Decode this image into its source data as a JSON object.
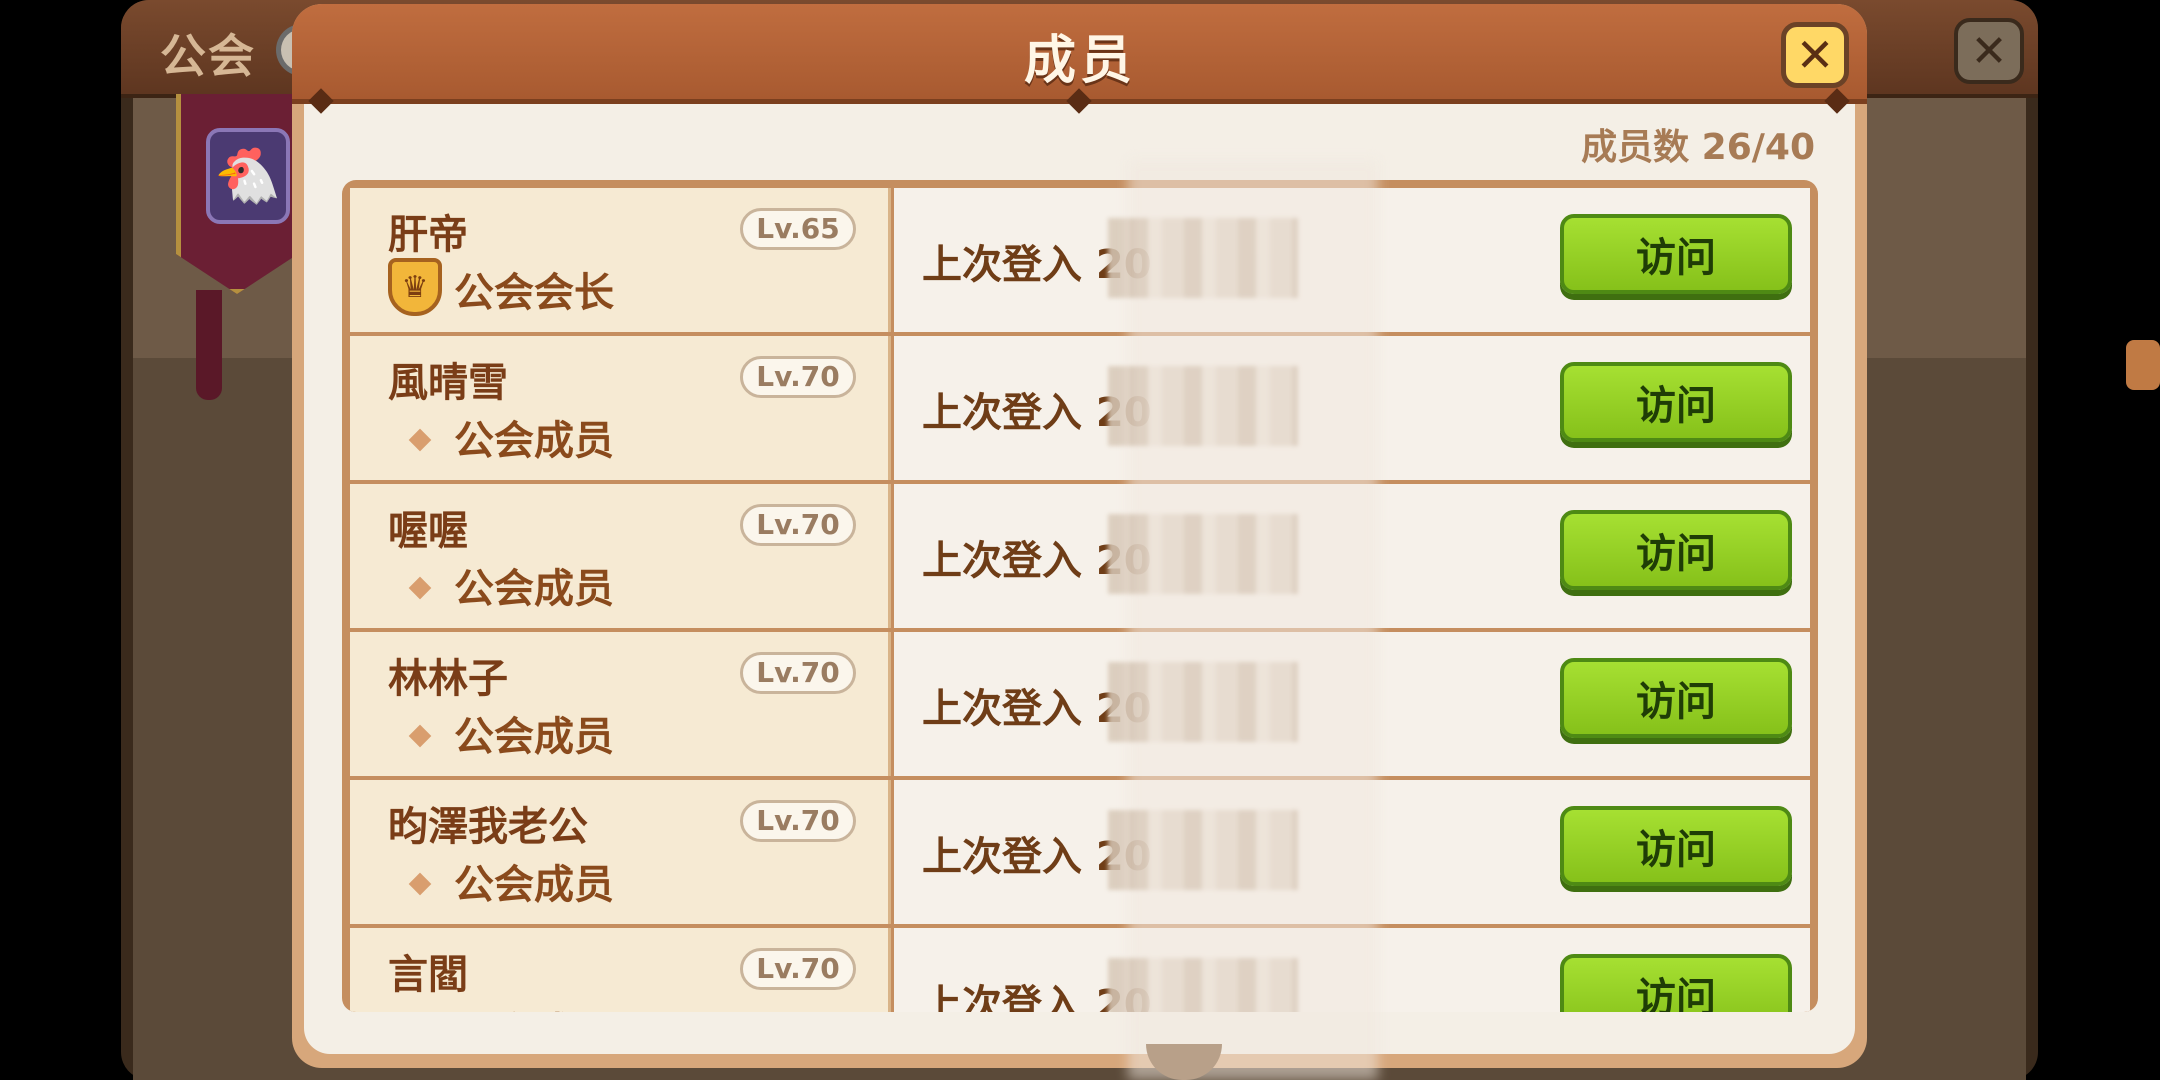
{
  "background": {
    "title": "公会"
  },
  "modal": {
    "title": "成员",
    "member_count": "成员数 26/40",
    "close_icon": "close-icon"
  },
  "members": [
    {
      "name": "肝帝",
      "level": "Lv.65",
      "role": "公会会长",
      "role_icon": "crown-icon",
      "last_login": "上次登入 20",
      "visit": "访问"
    },
    {
      "name": "風晴雪",
      "level": "Lv.70",
      "role": "公会成员",
      "role_icon": "diamond-icon",
      "last_login": "上次登入 20",
      "visit": "访问"
    },
    {
      "name": "喔喔",
      "level": "Lv.70",
      "role": "公会成员",
      "role_icon": "diamond-icon",
      "last_login": "上次登入 20",
      "visit": "访问"
    },
    {
      "name": "林林子",
      "level": "Lv.70",
      "role": "公会成员",
      "role_icon": "diamond-icon",
      "last_login": "上次登入 20",
      "visit": "访问"
    },
    {
      "name": "昀澤我老公",
      "level": "Lv.70",
      "role": "公会成员",
      "role_icon": "diamond-icon",
      "last_login": "上次登入 20",
      "visit": "访问"
    },
    {
      "name": "言閻",
      "level": "Lv.70",
      "role": "公会成员",
      "role_icon": "diamond-icon",
      "last_login": "上次登入 20",
      "visit": "访问"
    }
  ],
  "colors": {
    "header": "#b8623a",
    "visit_button": "#96d126",
    "name_text": "#7a3d17"
  }
}
